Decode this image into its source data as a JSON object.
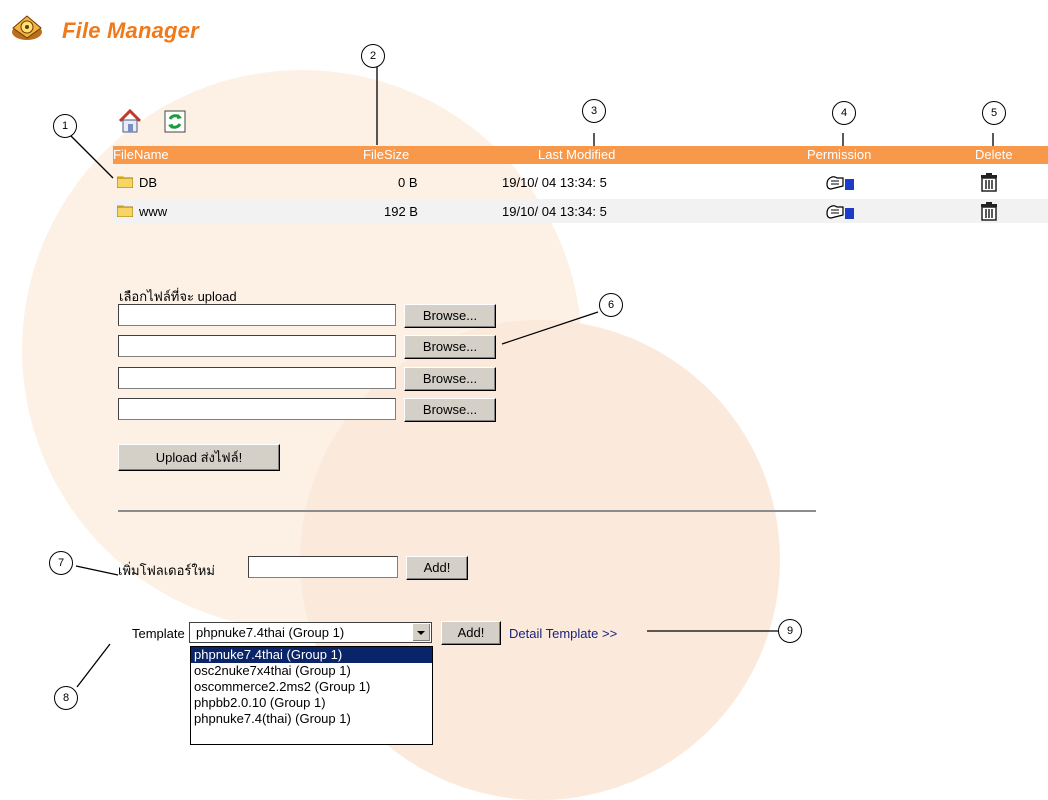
{
  "app": {
    "title": "File Manager"
  },
  "toolbar": {
    "home_icon": "home-icon",
    "refresh_icon": "refresh-icon"
  },
  "table": {
    "headers": [
      "FileName",
      "FileSize",
      "Last Modified",
      "Permission",
      "Delete"
    ],
    "rows": [
      {
        "name": "DB",
        "size": "0 B",
        "modified": "19/10/ 04 13:34: 5"
      },
      {
        "name": "www",
        "size": "192 B",
        "modified": "19/10/ 04 13:34: 5"
      }
    ]
  },
  "upload": {
    "label": "เลือกไฟล์ที่จะ upload",
    "browse_label": "Browse...",
    "submit_label": "Upload ส่งไฟล์!"
  },
  "new_folder": {
    "label": "เพิ่มโฟลเดอร์ใหม่",
    "button_label": "Add!"
  },
  "template": {
    "label": "Template",
    "selected": "phpnuke7.4thai (Group 1)",
    "button_label": "Add!",
    "detail_link": "Detail Template >>",
    "options": [
      "phpnuke7.4thai (Group 1)",
      "osc2nuke7x4thai (Group 1)",
      "oscommerce2.2ms2 (Group 1)",
      "phpbb2.0.10 (Group 1)",
      "phpnuke7.4(thai) (Group 1)"
    ]
  },
  "callouts": [
    "1",
    "2",
    "3",
    "4",
    "5",
    "6",
    "7",
    "8",
    "9"
  ],
  "colors": {
    "accent": "#f8984a",
    "title": "#f07a1a",
    "link": "#1a237e",
    "selection": "#0a246a"
  }
}
